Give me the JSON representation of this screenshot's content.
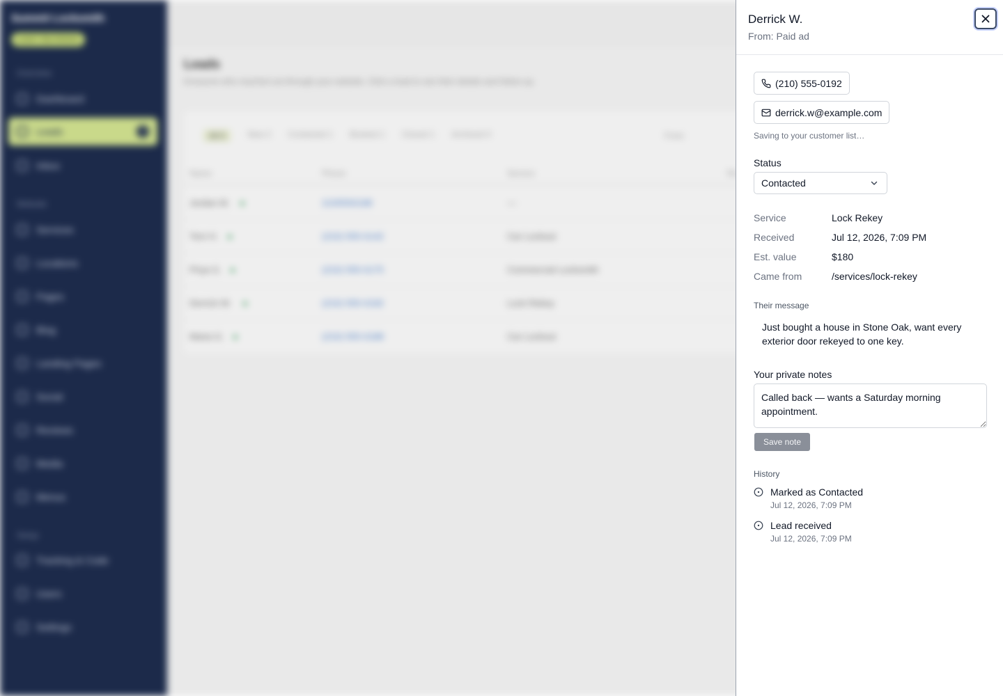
{
  "background": {
    "brand": "Summit Locksmith",
    "brand_badge": "Local • San Antonio",
    "sections": [
      "Overview",
      "Website",
      "Setup"
    ],
    "nav": [
      {
        "label": "Dashboard"
      },
      {
        "label": "Leads",
        "count": "1"
      },
      {
        "label": "Inbox"
      },
      {
        "label": "Services"
      },
      {
        "label": "Locations"
      },
      {
        "label": "Pages"
      },
      {
        "label": "Blog"
      },
      {
        "label": "Landing Pages"
      },
      {
        "label": "Social"
      },
      {
        "label": "Reviews"
      },
      {
        "label": "Media"
      },
      {
        "label": "Menus"
      },
      {
        "label": "Tracking & Code"
      },
      {
        "label": "Users"
      },
      {
        "label": "Settings"
      }
    ],
    "title": "Leads",
    "subtitle": "Everyone who reached out through your website. Click a lead to see their details and follow up.",
    "filters": [
      "All 5",
      "New 2",
      "Contacted 1",
      "Booked 1",
      "Closed 1",
      "Archived 0"
    ],
    "from_label": "From",
    "columns": [
      "Name",
      "Phone",
      "Service",
      "Re"
    ],
    "rows": [
      {
        "name": "Jordan M.",
        "phone": "2105550198",
        "service": "—"
      },
      {
        "name": "Tom H.",
        "phone": "(210) 555-0142",
        "service": "Car Lockout"
      },
      {
        "name": "Priya S.",
        "phone": "(210) 555-0175",
        "service": "Commercial Locksmith"
      },
      {
        "name": "Derrick W.",
        "phone": "(210) 555-0192",
        "service": "Lock Rekey"
      },
      {
        "name": "Maria G.",
        "phone": "(210) 555-0188",
        "service": "Car Lockout"
      }
    ]
  },
  "drawer": {
    "name": "Derrick W.",
    "source": "From: Paid ad",
    "phone": "(210) 555-0192",
    "email": "derrick.w@example.com",
    "saving_text": "Saving to your customer list…",
    "status_label": "Status",
    "status_value": "Contacted",
    "details": [
      {
        "label": "Service",
        "value": "Lock Rekey"
      },
      {
        "label": "Received",
        "value": "Jul 12, 2026, 7:09 PM"
      },
      {
        "label": "Est. value",
        "value": "$180"
      },
      {
        "label": "Came from",
        "value": "/services/lock-rekey"
      }
    ],
    "message_label": "Their message",
    "message": "Just bought a house in Stone Oak, want every exterior door rekeyed to one key.",
    "notes_label": "Your private notes",
    "notes_value": "Called back — wants a Saturday morning appointment.",
    "save_label": "Save note",
    "history_label": "History",
    "history": [
      {
        "title": "Marked as Contacted",
        "time": "Jul 12, 2026, 7:09 PM"
      },
      {
        "title": "Lead received",
        "time": "Jul 12, 2026, 7:09 PM"
      }
    ]
  }
}
